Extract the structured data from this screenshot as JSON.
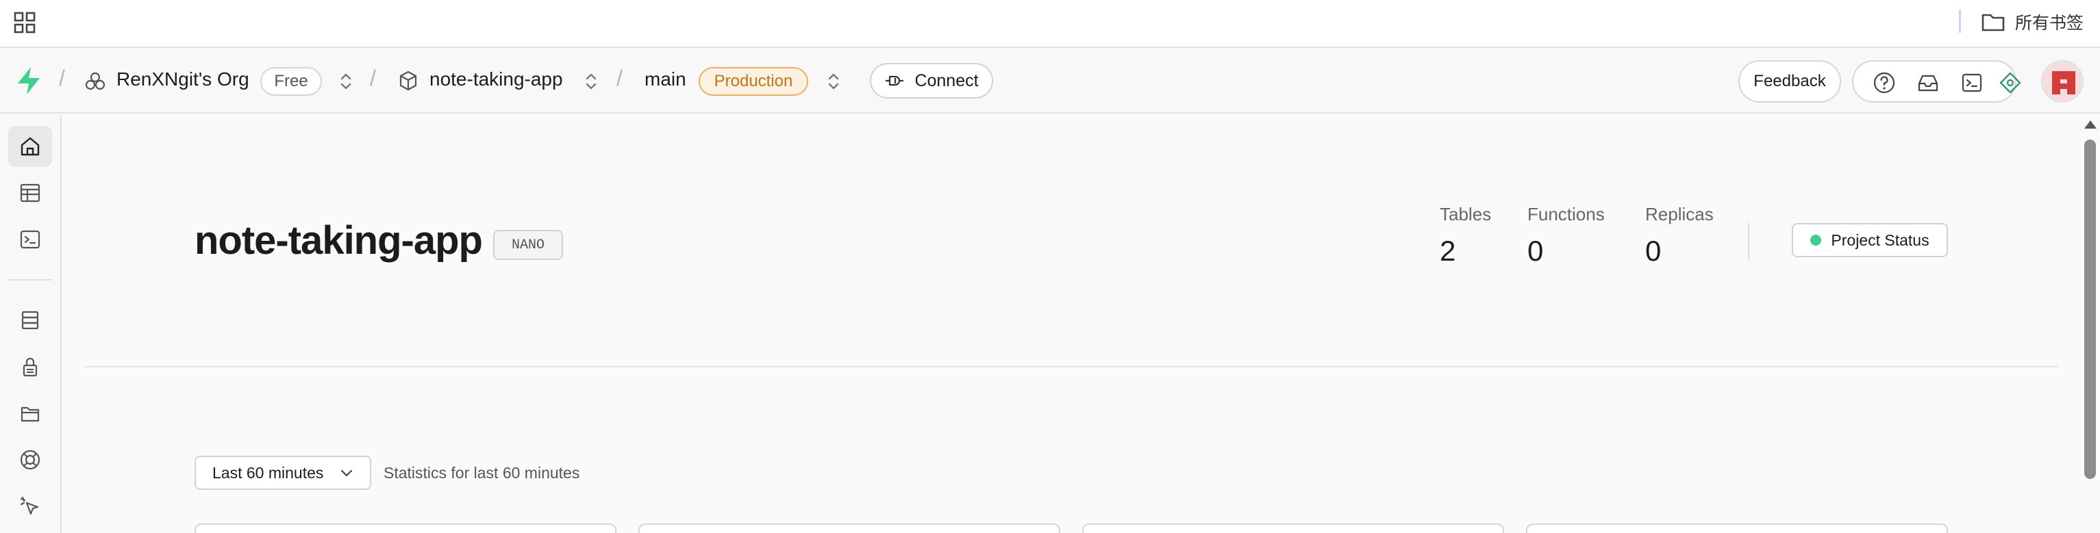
{
  "browser": {
    "bookmarks_folder_label": "所有书签"
  },
  "header": {
    "org_name": "RenXNgit's Org",
    "org_plan": "Free",
    "project_name": "note-taking-app",
    "branch_name": "main",
    "branch_env": "Production",
    "connect_label": "Connect",
    "feedback_label": "Feedback"
  },
  "sidebar": {
    "items": [
      {
        "icon": "home-icon",
        "active": true
      },
      {
        "icon": "table-editor-icon",
        "active": false
      },
      {
        "icon": "sql-editor-icon",
        "active": false
      },
      {
        "icon": "database-icon",
        "active": false
      },
      {
        "icon": "auth-lock-icon",
        "active": false
      },
      {
        "icon": "storage-icon",
        "active": false
      },
      {
        "icon": "realtime-icon",
        "active": false
      },
      {
        "icon": "edge-functions-icon",
        "active": false
      }
    ]
  },
  "main": {
    "title": "note-taking-app",
    "tier_badge": "NANO",
    "stats": [
      {
        "label": "Tables",
        "value": "2"
      },
      {
        "label": "Functions",
        "value": "0"
      },
      {
        "label": "Replicas",
        "value": "0"
      }
    ],
    "status_button_label": "Project Status",
    "time_range_selected": "Last 60 minutes",
    "time_range_caption": "Statistics for last 60 minutes"
  },
  "colors": {
    "brand_green": "#3ecf8e",
    "production_orange": "#c07516",
    "avatar_red": "#d23c3c"
  }
}
